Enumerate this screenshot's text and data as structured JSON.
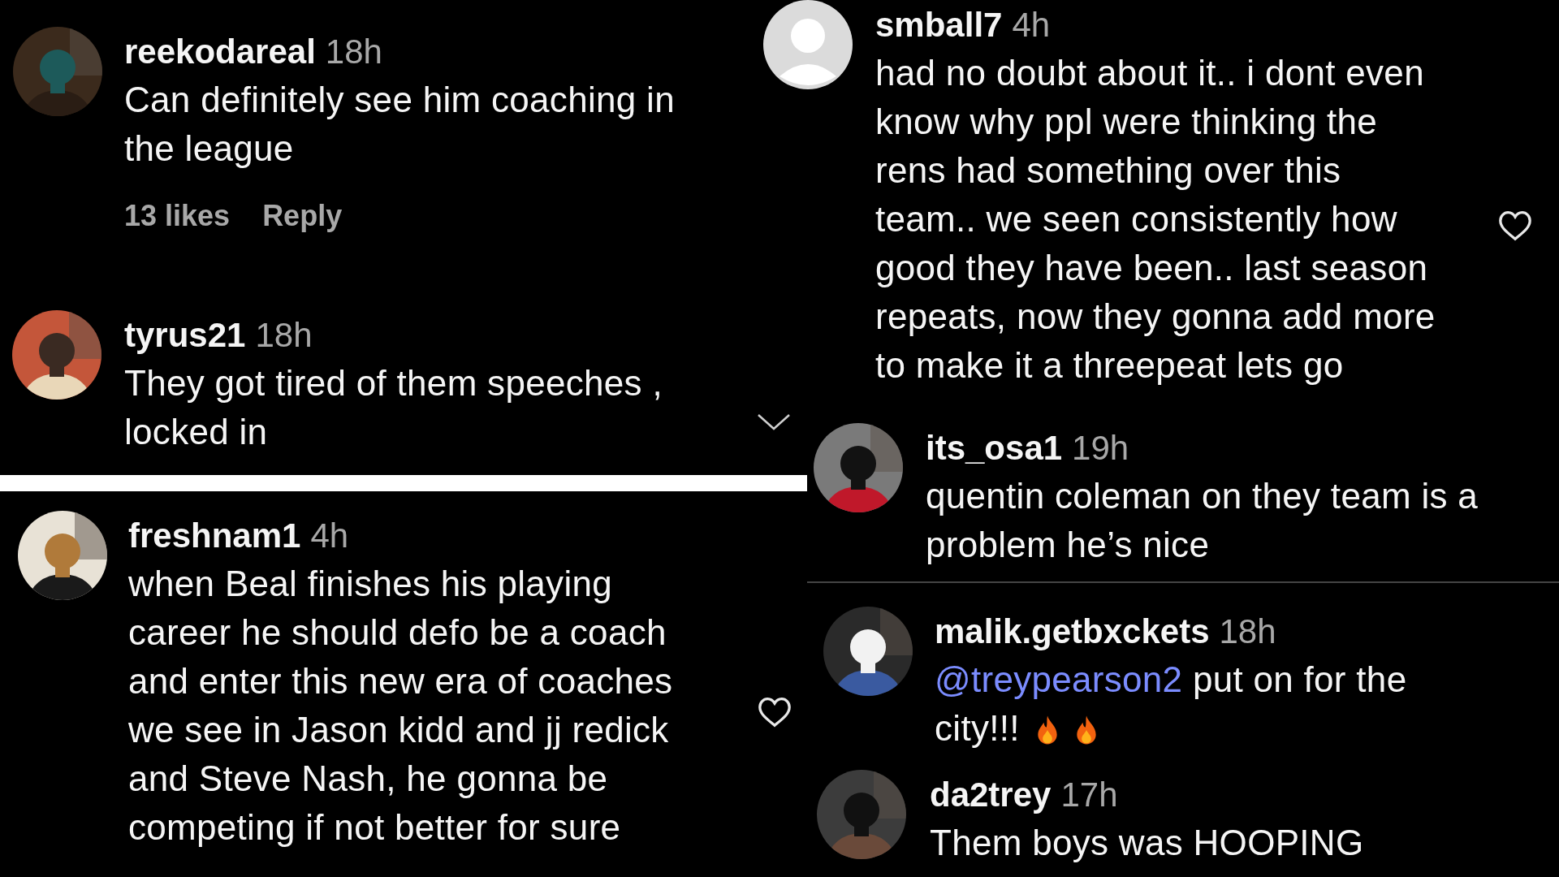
{
  "comments": [
    {
      "username": "reekodareal",
      "time": "18h",
      "avatar": {
        "kind": "picture"
      },
      "lines": [
        "Can definitely see him coaching in",
        "the league"
      ],
      "likes": "13 likes",
      "reply": "Reply"
    },
    {
      "username": "tyrus21",
      "time": "18h",
      "avatar": {
        "kind": "picture"
      },
      "lines": [
        "They got tired of them speeches ,",
        "locked in"
      ]
    },
    {
      "username": "freshnam1",
      "time": "4h",
      "avatar": {
        "kind": "picture"
      },
      "lines": [
        "when Beal finishes his playing",
        "career he should defo be a coach",
        "and enter this new era of coaches",
        "we see in Jason kidd and jj redick",
        "and Steve Nash, he gonna be",
        "competing if not better for sure"
      ],
      "liked": false
    },
    {
      "username": "smball7",
      "time": "4h",
      "avatar": {
        "kind": "default"
      },
      "lines": [
        "had no doubt about it.. i dont even",
        "know why ppl were thinking the",
        "rens had something over this",
        "team.. we seen consistently how",
        "good they have been.. last season",
        "repeats, now they gonna add more",
        "to make it a threepeat lets go"
      ],
      "liked": false
    },
    {
      "username": "its_osa1",
      "time": "19h",
      "avatar": {
        "kind": "picture"
      },
      "lines": [
        "quentin coleman on they team is a",
        "problem he’s nice"
      ]
    },
    {
      "username": "malik.getbxckets",
      "time": "18h",
      "avatar": {
        "kind": "picture"
      },
      "mention": "@treypearson2",
      "lines": [
        " put on for the",
        "city!!!"
      ],
      "emojis": [
        {
          "kind": "fire"
        },
        {
          "kind": "fire"
        }
      ]
    },
    {
      "username": "da2trey",
      "time": "17h",
      "avatar": {
        "kind": "picture"
      },
      "lines": [
        "Them boys was HOOPING"
      ]
    }
  ]
}
